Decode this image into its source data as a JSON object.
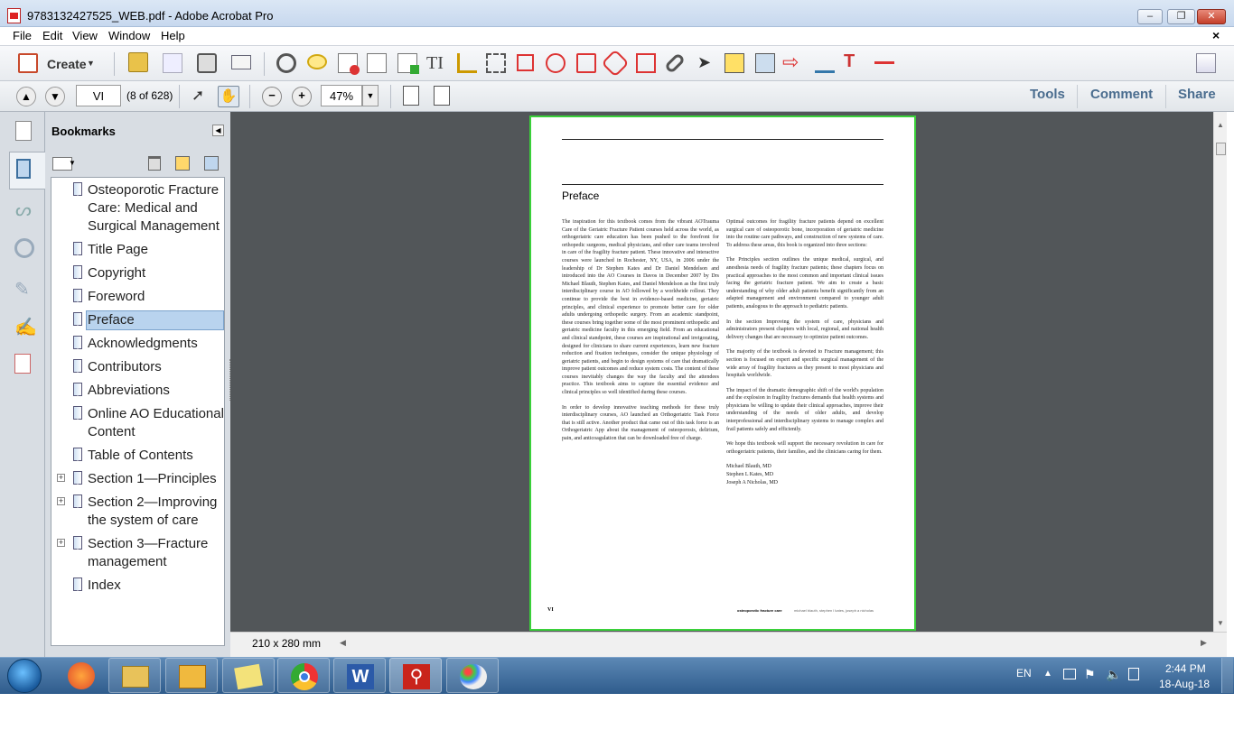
{
  "window": {
    "title": "9783132427525_WEB.pdf - Adobe Acrobat Pro",
    "minimize": "–",
    "maximize": "❐",
    "close": "✕"
  },
  "menu": [
    "File",
    "Edit",
    "View",
    "Window",
    "Help"
  ],
  "toolbar": {
    "create_label": "Create"
  },
  "nav": {
    "page_value": "VI",
    "page_count": "(8 of 628)",
    "zoom_value": "47%"
  },
  "right_tabs": [
    "Tools",
    "Comment",
    "Share"
  ],
  "bookmarks": {
    "title": "Bookmarks",
    "items": [
      {
        "label": "Osteoporotic Fracture Care: Medical and Surgical Management",
        "expandable": false,
        "selected": false
      },
      {
        "label": "Title Page",
        "expandable": false,
        "selected": false
      },
      {
        "label": "Copyright",
        "expandable": false,
        "selected": false
      },
      {
        "label": "Foreword",
        "expandable": false,
        "selected": false
      },
      {
        "label": "Preface",
        "expandable": false,
        "selected": true
      },
      {
        "label": "Acknowledgments",
        "expandable": false,
        "selected": false
      },
      {
        "label": "Contributors",
        "expandable": false,
        "selected": false
      },
      {
        "label": "Abbreviations",
        "expandable": false,
        "selected": false
      },
      {
        "label": "Online AO Educational Content",
        "expandable": false,
        "selected": false
      },
      {
        "label": "Table of Contents",
        "expandable": false,
        "selected": false
      },
      {
        "label": "Section 1—Principles",
        "expandable": true,
        "selected": false
      },
      {
        "label": "Section 2—Improving the system of care",
        "expandable": true,
        "selected": false
      },
      {
        "label": "Section 3—Fracture management",
        "expandable": true,
        "selected": false
      },
      {
        "label": "Index",
        "expandable": false,
        "selected": false
      }
    ]
  },
  "document": {
    "heading": "Preface",
    "left_paragraphs": [
      "The inspiration for this textbook comes from the vibrant AOTrauma Care of the Geriatric Fracture Patient courses held across the world, as orthogeriatric care education has been pushed to the forefront for orthopedic surgeons, medical physicians, and other care teams involved in care of the fragility fracture patient. These innovative and interactive courses were launched in Rochester, NY, USA, in 2006 under the leadership of Dr Stephen Kates and Dr Daniel Mendelson and introduced into the AO Courses in Davos in December 2007 by Drs Michael Blauth, Stephen Kates, and Daniel Mendelson as the first truly interdisciplinary course in AO followed by a worldwide rollout. They continue to provide the best in evidence-based medicine, geriatric principles, and clinical experience to promote better care for older adults undergoing orthopedic surgery. From an academic standpoint, these courses bring together some of the most prominent orthopedic and geriatric medicine faculty in this emerging field. From an educational and clinical standpoint, these courses are inspirational and invigorating, designed for clinicians to share current experiences, learn new fracture reduction and fixation techniques, consider the unique physiology of geriatric patients, and begin to design systems of care that dramatically improve patient outcomes and reduce system costs. The content of these courses inevitably changes the way the faculty and the attendees practice. This textbook aims to capture the essential evidence and clinical principles so well identified during these courses.",
      "In order to develop innovative teaching methods for these truly interdisciplinary courses, AO launched an Orthogeriatric Task Force that is still active. Another product that came out of this task force is an Orthogeriatric App about the management of osteoporosis, delirium, pain, and anticoagulation that can be downloaded free of charge."
    ],
    "right_paragraphs": [
      "Optimal outcomes for fragility fracture patients depend on excellent surgical care of osteoporotic bone, incorporation of geriatric medicine into the routine care pathways, and construction of new systems of care. To address these areas, this book is organized into three sections:",
      "The Principles section outlines the unique medical, surgical, and anesthesia needs of fragility fracture patients; these chapters focus on practical approaches to the most common and important clinical issues facing the geriatric fracture patient. We aim to create a basic understanding of why older adult patients benefit significantly from an adapted management and environment compared to younger adult patients, analogous to the approach to pediatric patients.",
      "In the section Improving the system of care, physicians and administrators present chapters with local, regional, and national health delivery changes that are necessary to optimize patient outcomes.",
      "The majority of the textbook is devoted to Fracture management; this section is focused on expert and specific surgical management of the wide array of fragility fractures as they present to most physicians and hospitals worldwide.",
      "The impact of the dramatic demographic shift of the world's population and the explosion in fragility fractures demands that health systems and physicians be willing to update their clinical approaches, improve their understanding of the needs of older adults, and develop interprofessional and interdisciplinary systems to manage complex and frail patients safely and efficiently.",
      "We hope this textbook will support the necessary revolution in care for orthogeriatric patients, their families, and the clinicians caring for them."
    ],
    "signatures": [
      "Michael Blauth, MD",
      "Stephen L Kates, MD",
      "Joseph A Nicholas, MD"
    ],
    "footer_page": "VI",
    "footer_title": "osteoporotic fracture care",
    "footer_authors": "michael blauth, stephen l kates, joseph a nicholas",
    "page_size": "210 x 280 mm"
  },
  "taskbar": {
    "lang": "EN",
    "time": "2:44 PM",
    "date": "18-Aug-18"
  }
}
